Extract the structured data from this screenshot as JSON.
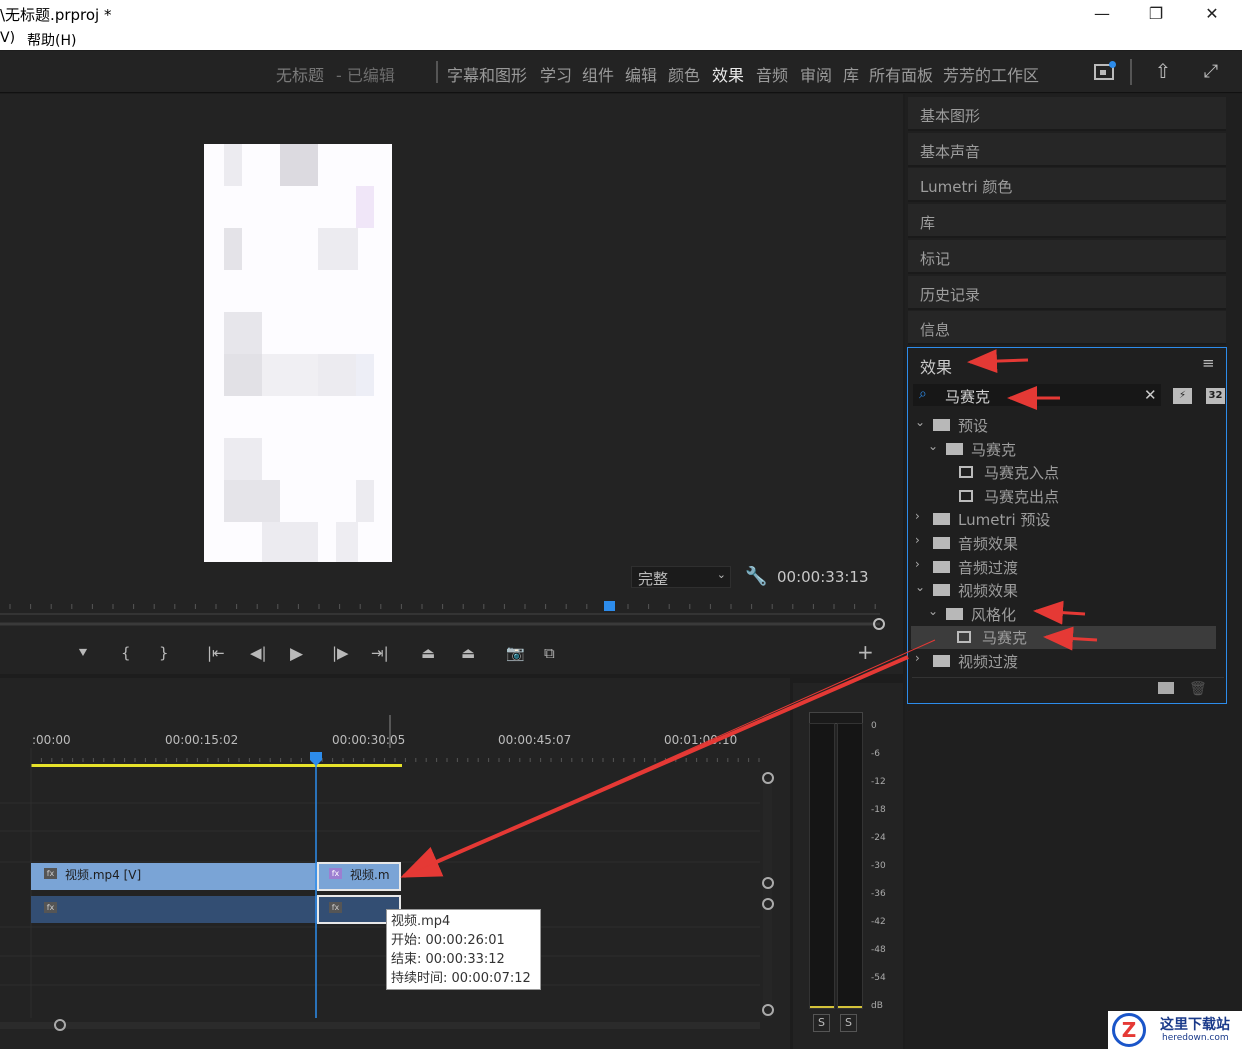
{
  "window": {
    "title": "\\无标题.prproj *",
    "minimize": "—",
    "maximize": "❐",
    "close": "✕"
  },
  "menu": {
    "partial": "V)",
    "help": "帮助(H)"
  },
  "workspace": {
    "project_title": "无标题",
    "project_state": "- 已编辑",
    "tabs": [
      "字幕和图形",
      "学习",
      "组件",
      "编辑",
      "颜色",
      "效果",
      "音频",
      "审阅",
      "库",
      "所有面板",
      "芳芳的工作区"
    ],
    "active_tab": "效果"
  },
  "monitor": {
    "fit_select": "完整",
    "timecode": "00:00:33:13",
    "add_label": "+"
  },
  "panels": [
    "基本图形",
    "基本声音",
    "Lumetri 颜色",
    "库",
    "标记",
    "历史记录",
    "信息"
  ],
  "effects": {
    "title": "效果",
    "search_value": "马赛克",
    "badge_32": "32",
    "tree": [
      {
        "label": "预设",
        "level": 0,
        "expanded": true,
        "icon": "preset-folder-icon"
      },
      {
        "label": "马赛克",
        "level": 1,
        "expanded": true,
        "icon": "preset-folder-icon"
      },
      {
        "label": "马赛克入点",
        "level": 2,
        "icon": "preset-icon"
      },
      {
        "label": "马赛克出点",
        "level": 2,
        "icon": "preset-icon"
      },
      {
        "label": "Lumetri 预设",
        "level": 0,
        "expanded": false,
        "icon": "preset-folder-icon"
      },
      {
        "label": "音频效果",
        "level": 0,
        "expanded": false,
        "icon": "folder-icon"
      },
      {
        "label": "音频过渡",
        "level": 0,
        "expanded": false,
        "icon": "folder-icon"
      },
      {
        "label": "视频效果",
        "level": 0,
        "expanded": true,
        "icon": "folder-icon"
      },
      {
        "label": "风格化",
        "level": 1,
        "expanded": true,
        "icon": "folder-icon"
      },
      {
        "label": "马赛克",
        "level": 2,
        "icon": "effect-icon",
        "selected": true
      },
      {
        "label": "视频过渡",
        "level": 0,
        "expanded": false,
        "icon": "folder-icon"
      }
    ]
  },
  "timeline": {
    "ruler": [
      ":00:00",
      "00:00:15:02",
      "00:00:30:05",
      "00:00:45:07",
      "00:01:00:10"
    ],
    "clip1_label": "视频.mp4 [V]",
    "clip2_label": "视频.m",
    "fx": "fx",
    "tooltip": [
      "视频.mp4",
      "开始: 00:00:26:01",
      "结束: 00:00:33:12",
      "持续时间: 00:00:07:12"
    ]
  },
  "meter": {
    "labels": [
      "0",
      "-6",
      "-12",
      "-18",
      "-24",
      "-30",
      "-36",
      "-42",
      "-48",
      "-54",
      "dB"
    ],
    "solo": [
      "S",
      "S"
    ]
  },
  "watermark": {
    "text": "这里下载站",
    "url": "heredown.com"
  },
  "colors": {
    "accent": "#2d8ceb",
    "clip_video": "#7aa4d6",
    "clip_audio": "#334e73",
    "arrow": "#e53935",
    "playhead": "#2d8ceb",
    "workbar": "#e6e22a"
  }
}
